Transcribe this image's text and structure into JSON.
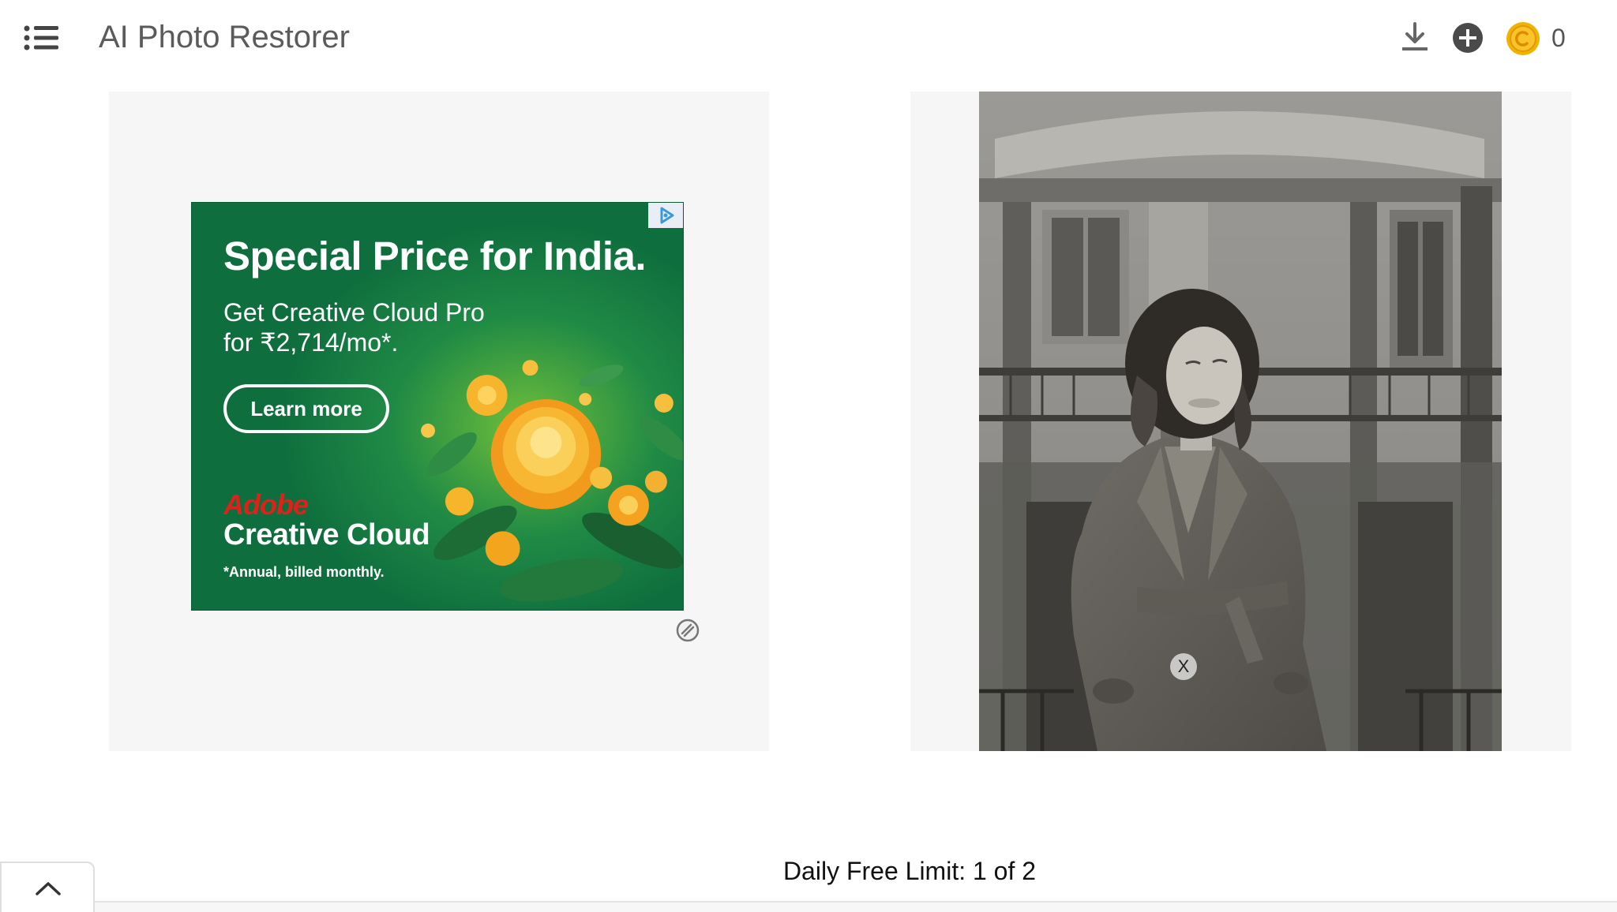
{
  "header": {
    "menu_icon": "list-menu-icon",
    "title": "AI Photo Restorer",
    "download_icon": "download-icon",
    "add_icon": "plus-circle-icon",
    "coin_icon": "coin-icon",
    "coin_count": "0"
  },
  "ad": {
    "headline": "Special Price for India.",
    "subline_1": "Get Creative Cloud Pro",
    "subline_2": "for ₹2,714/mo*.",
    "cta": "Learn more",
    "brand": "Adobe",
    "product": "Creative Cloud",
    "fine_print": "*Annual, billed monthly.",
    "adchoices_icon": "adchoices-icon",
    "feedback_icon": "ad-feedback-icon",
    "background_color": "#0f6e3e",
    "brand_color": "#e0201a"
  },
  "photo": {
    "close_label": "X"
  },
  "footer": {
    "limit_text": "Daily Free Limit: 1 of 2",
    "collapse_icon": "chevron-up-icon"
  }
}
